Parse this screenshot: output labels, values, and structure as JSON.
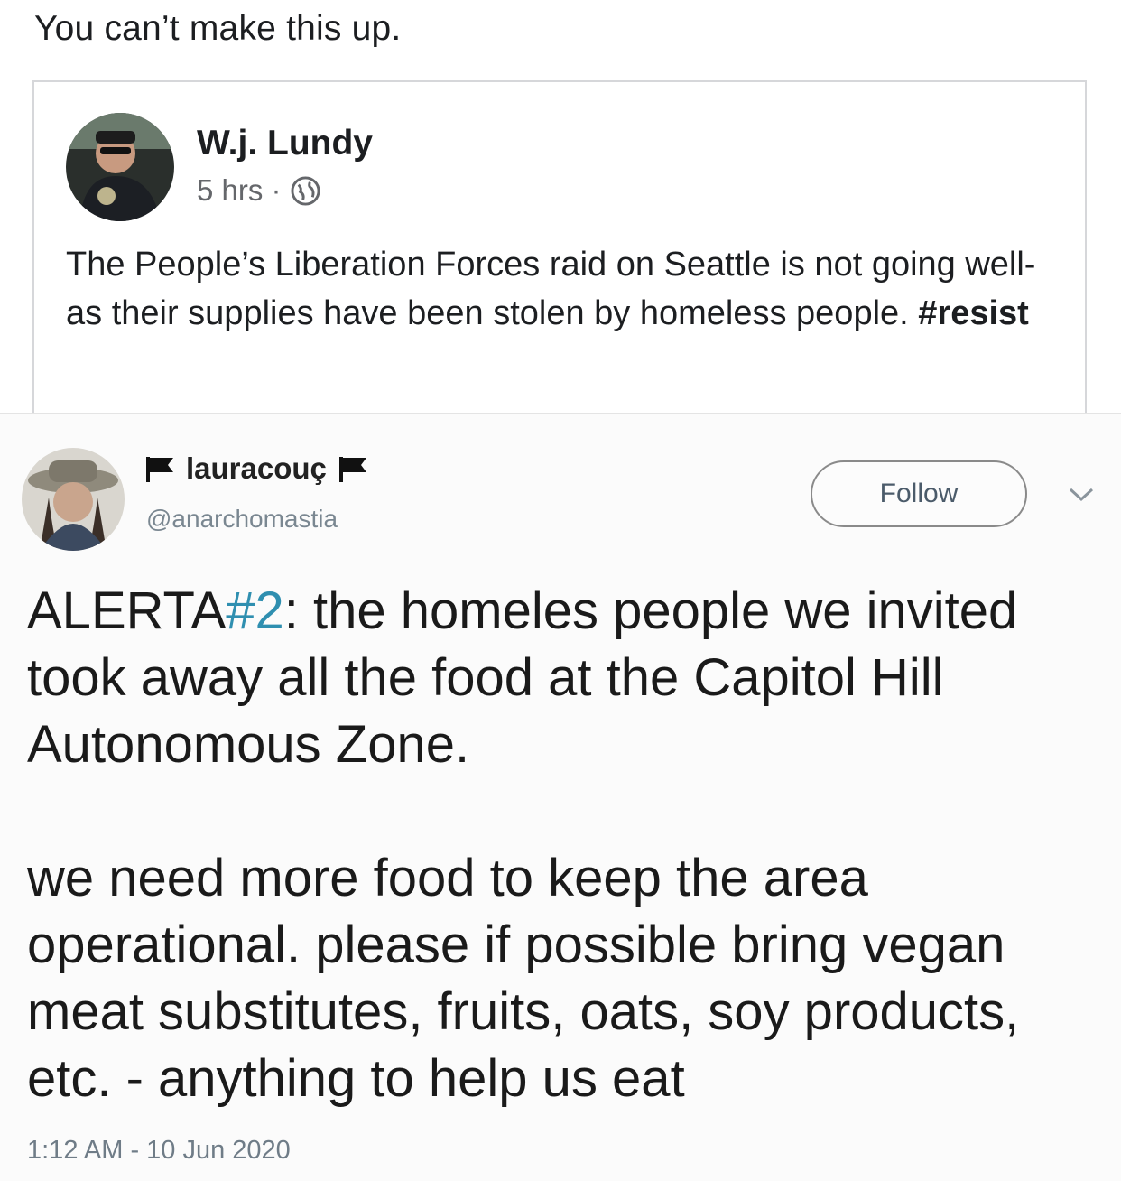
{
  "caption": "You can’t make this up.",
  "fb_post": {
    "author": "W.j. Lundy",
    "time": "5 hrs ·",
    "privacy_icon": "globe-icon",
    "body_text": "The People’s Liberation Forces raid on Seattle is not going well- as their supplies have been stolen by homeless people. ",
    "hashtag": "#resist"
  },
  "tweet": {
    "display_name": "lauracouç",
    "handle": "@anarchomastia",
    "follow_label": "Follow",
    "alert_prefix": "ALERTA",
    "alert_hashtag": "#2",
    "paragraph1_rest": ": the homeles people we invited took away all the food at the Capitol Hill Autonomous Zone.",
    "paragraph2": "we need more food to keep the area operational. please if possible bring vegan meat substitutes, fruits, oats, soy products, etc. - anything to help us eat",
    "timestamp": "1:12 AM - 10 Jun 2020",
    "icons": {
      "flag": "black-flag-icon",
      "menu": "chevron-down-icon"
    }
  },
  "colors": {
    "fb_text": "#1c1e21",
    "fb_meta": "#65676b",
    "tweet_hashtag": "#2f8fb0",
    "tweet_meta": "#6f7c87"
  }
}
